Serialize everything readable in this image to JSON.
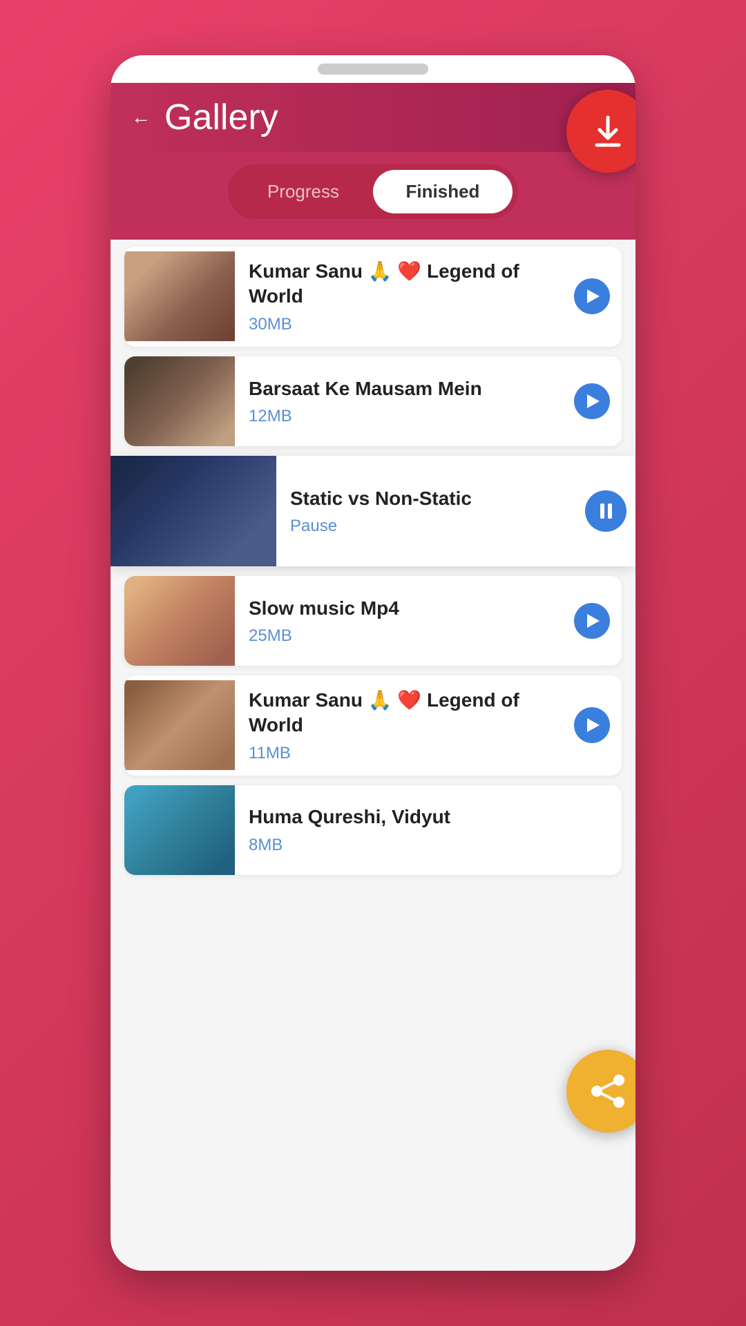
{
  "app": {
    "title": "Gallery",
    "back_label": "←"
  },
  "tabs": {
    "progress_label": "Progress",
    "finished_label": "Finished",
    "active": "finished"
  },
  "items": [
    {
      "id": 1,
      "title": "Kumar Sanu 🙏 ❤️ Legend of World",
      "size": "30MB",
      "status": "finished",
      "thumb_class": "thumb-1"
    },
    {
      "id": 2,
      "title": "Barsaat Ke Mausam Mein",
      "size": "12MB",
      "status": "finished",
      "thumb_class": "thumb-2"
    },
    {
      "id": 3,
      "title": "Static vs Non-Static",
      "size": "Pause",
      "status": "playing",
      "thumb_class": "thumb-3"
    },
    {
      "id": 4,
      "title": "Slow music Mp4",
      "size": "25MB",
      "status": "finished",
      "thumb_class": "thumb-4"
    },
    {
      "id": 5,
      "title": "Kumar Sanu 🙏 ❤️ Legend of World",
      "size": "11MB",
      "status": "finished",
      "thumb_class": "thumb-5"
    },
    {
      "id": 6,
      "title": "Huma Qureshi, Vidyut",
      "size": "8MB",
      "status": "finished",
      "thumb_class": "thumb-6"
    }
  ],
  "fabs": {
    "download_label": "download",
    "share_label": "share"
  }
}
